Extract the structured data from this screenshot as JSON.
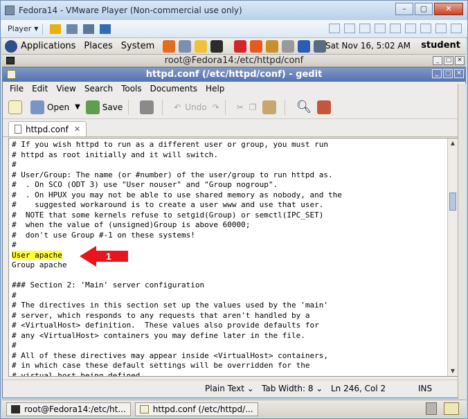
{
  "vmware": {
    "title": "Fedora14 - VMware Player (Non-commercial use only)",
    "player_label": "Player"
  },
  "panel": {
    "menus": [
      "Applications",
      "Places",
      "System"
    ],
    "clock": "Sat Nov 16,  5:02 AM",
    "user": "student"
  },
  "terminal": {
    "title": "root@Fedora14:/etc/httpd/conf"
  },
  "gedit": {
    "title": "httpd.conf (/etc/httpd/conf) - gedit",
    "menus": [
      "File",
      "Edit",
      "View",
      "Search",
      "Tools",
      "Documents",
      "Help"
    ],
    "toolbar": {
      "open_label": "Open",
      "save_label": "Save",
      "undo_label": "Undo"
    },
    "tab_label": "httpd.conf",
    "code_lines": [
      "# If you wish httpd to run as a different user or group, you must run",
      "# httpd as root initially and it will switch.",
      "#",
      "# User/Group: The name (or #number) of the user/group to run httpd as.",
      "#  . On SCO (ODT 3) use \"User nouser\" and \"Group nogroup\".",
      "#  . On HPUX you may not be able to use shared memory as nobody, and the",
      "#    suggested workaround is to create a user www and use that user.",
      "#  NOTE that some kernels refuse to setgid(Group) or semctl(IPC_SET)",
      "#  when the value of (unsigned)Group is above 60000;",
      "#  don't use Group #-1 on these systems!",
      "#",
      "User apache",
      "Group apache",
      "",
      "### Section 2: 'Main' server configuration",
      "#",
      "# The directives in this section set up the values used by the 'main'",
      "# server, which responds to any requests that aren't handled by a",
      "# <VirtualHost> definition.  These values also provide defaults for",
      "# any <VirtualHost> containers you may define later in the file.",
      "#",
      "# All of these directives may appear inside <VirtualHost> containers,",
      "# in which case these default settings will be overridden for the",
      "# virtual host being defined."
    ],
    "highlighted_line": "User apache",
    "annotation_number": "1",
    "status": {
      "syntax": "Plain Text",
      "tab_width": "Tab Width:  8",
      "position": "Ln 246, Col 2",
      "mode": "INS"
    }
  },
  "taskbar": {
    "tasks": [
      "root@Fedora14:/etc/ht...",
      "httpd.conf (/etc/httpd/..."
    ]
  },
  "colors": {
    "highlight": "#ffff3b",
    "arrow": "#e8141e"
  }
}
